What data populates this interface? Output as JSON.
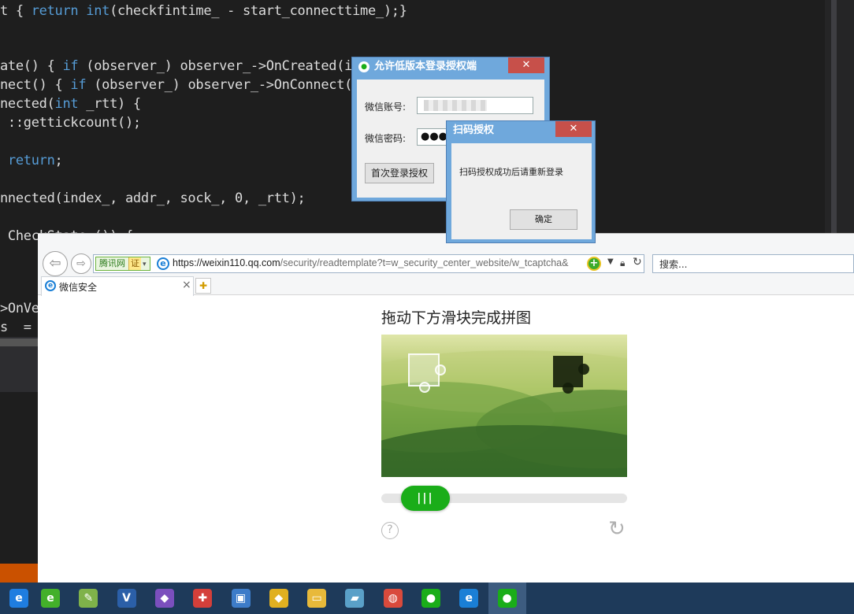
{
  "editor": {
    "lines": [
      {
        "parts": [
          {
            "t": "t { ",
            "k": 0
          },
          {
            "t": "return",
            "k": 1
          },
          {
            "t": " ",
            "k": 0
          },
          {
            "t": "int",
            "k": 1
          },
          {
            "t": "(checkfintime_ - start_connecttime_);}",
            "k": 0
          }
        ]
      },
      {
        "parts": [
          {
            "t": "ate() { ",
            "k": 0
          },
          {
            "t": "if",
            "k": 1
          },
          {
            "t": " (observer_) observer_->OnCreated(i",
            "k": 0
          }
        ]
      },
      {
        "parts": [
          {
            "t": "nect() { ",
            "k": 0
          },
          {
            "t": "if",
            "k": 1
          },
          {
            "t": " (observer_) observer_->OnConnect(",
            "k": 0
          }
        ]
      },
      {
        "parts": [
          {
            "t": "nected(",
            "k": 0
          },
          {
            "t": "int",
            "k": 1
          },
          {
            "t": " _rtt) {",
            "k": 0
          }
        ]
      },
      {
        "parts": [
          {
            "t": " ::gettickcount();",
            "k": 0
          }
        ]
      },
      {
        "parts": [
          {
            "t": " ",
            "k": 0
          },
          {
            "t": "return",
            "k": 1
          },
          {
            "t": ";",
            "k": 0
          }
        ]
      },
      {
        "parts": [
          {
            "t": "nnected(index_, addr_, sock_, 0, _rtt);",
            "k": 0
          }
        ]
      },
      {
        "parts": [
          {
            "t": " CheckState_()) {",
            "k": 0
          }
        ]
      },
      {
        "parts": [
          {
            "t": ">OnVe",
            "k": 0
          }
        ]
      },
      {
        "parts": [
          {
            "t": "s  =",
            "k": 0
          }
        ]
      }
    ]
  },
  "browser": {
    "address": {
      "site_badge": "腾讯网",
      "cert_badge": "证",
      "url_main": "https://weixin110.qq.com",
      "url_rest": "/security/readtemplate?t=w_security_center_website/w_tcaptcha&"
    },
    "search_placeholder": "搜索...",
    "tab_label": "微信安全",
    "tab_close": "×",
    "new_tab": "✚"
  },
  "captcha": {
    "title": "拖动下方滑块完成拼图",
    "slider_grip": "|||",
    "slider_progress": 0.08,
    "help_glyph": "?",
    "refresh_glyph": "↻"
  },
  "login_dialog": {
    "title": "允许低版本登录授权端",
    "close_glyph": "✕",
    "account_label": "微信账号:",
    "password_label": "微信密码:",
    "password_mask": "●●●●●●●",
    "first_login_button": "首次登录授权"
  },
  "qr_dialog": {
    "title": "扫码授权",
    "close_glyph": "✕",
    "message": "扫码授权成功后请重新登录",
    "ok_button": "确定"
  },
  "taskbar": {
    "items": [
      {
        "icon": "edge-icon",
        "glyph": "e",
        "color": "#1f7de0"
      },
      {
        "icon": "browser-360-icon",
        "glyph": "e",
        "color": "#43b02a"
      },
      {
        "icon": "notepad-icon",
        "glyph": "✎",
        "color": "#7fb24a"
      },
      {
        "icon": "visio-icon",
        "glyph": "V",
        "color": "#2b5fa8"
      },
      {
        "icon": "visual-studio-icon",
        "glyph": "◆",
        "color": "#7b4fbd"
      },
      {
        "icon": "colorful-app-icon",
        "glyph": "✚",
        "color": "#d43f3a"
      },
      {
        "icon": "remote-desktop-icon",
        "glyph": "▣",
        "color": "#3d7cc9"
      },
      {
        "icon": "git-icon",
        "glyph": "◆",
        "color": "#e0b020"
      },
      {
        "icon": "folder-icon",
        "glyph": "▭",
        "color": "#e8b93a"
      },
      {
        "icon": "book-icon",
        "glyph": "▰",
        "color": "#5aa0c8"
      },
      {
        "icon": "paint-icon",
        "glyph": "◍",
        "color": "#d94a3c"
      },
      {
        "icon": "wechat-icon",
        "glyph": "●",
        "color": "#1aad19"
      },
      {
        "icon": "ie-icon",
        "glyph": "e",
        "color": "#1a7fd6"
      },
      {
        "icon": "wechat-active-icon",
        "glyph": "●",
        "color": "#1aad19"
      }
    ]
  }
}
